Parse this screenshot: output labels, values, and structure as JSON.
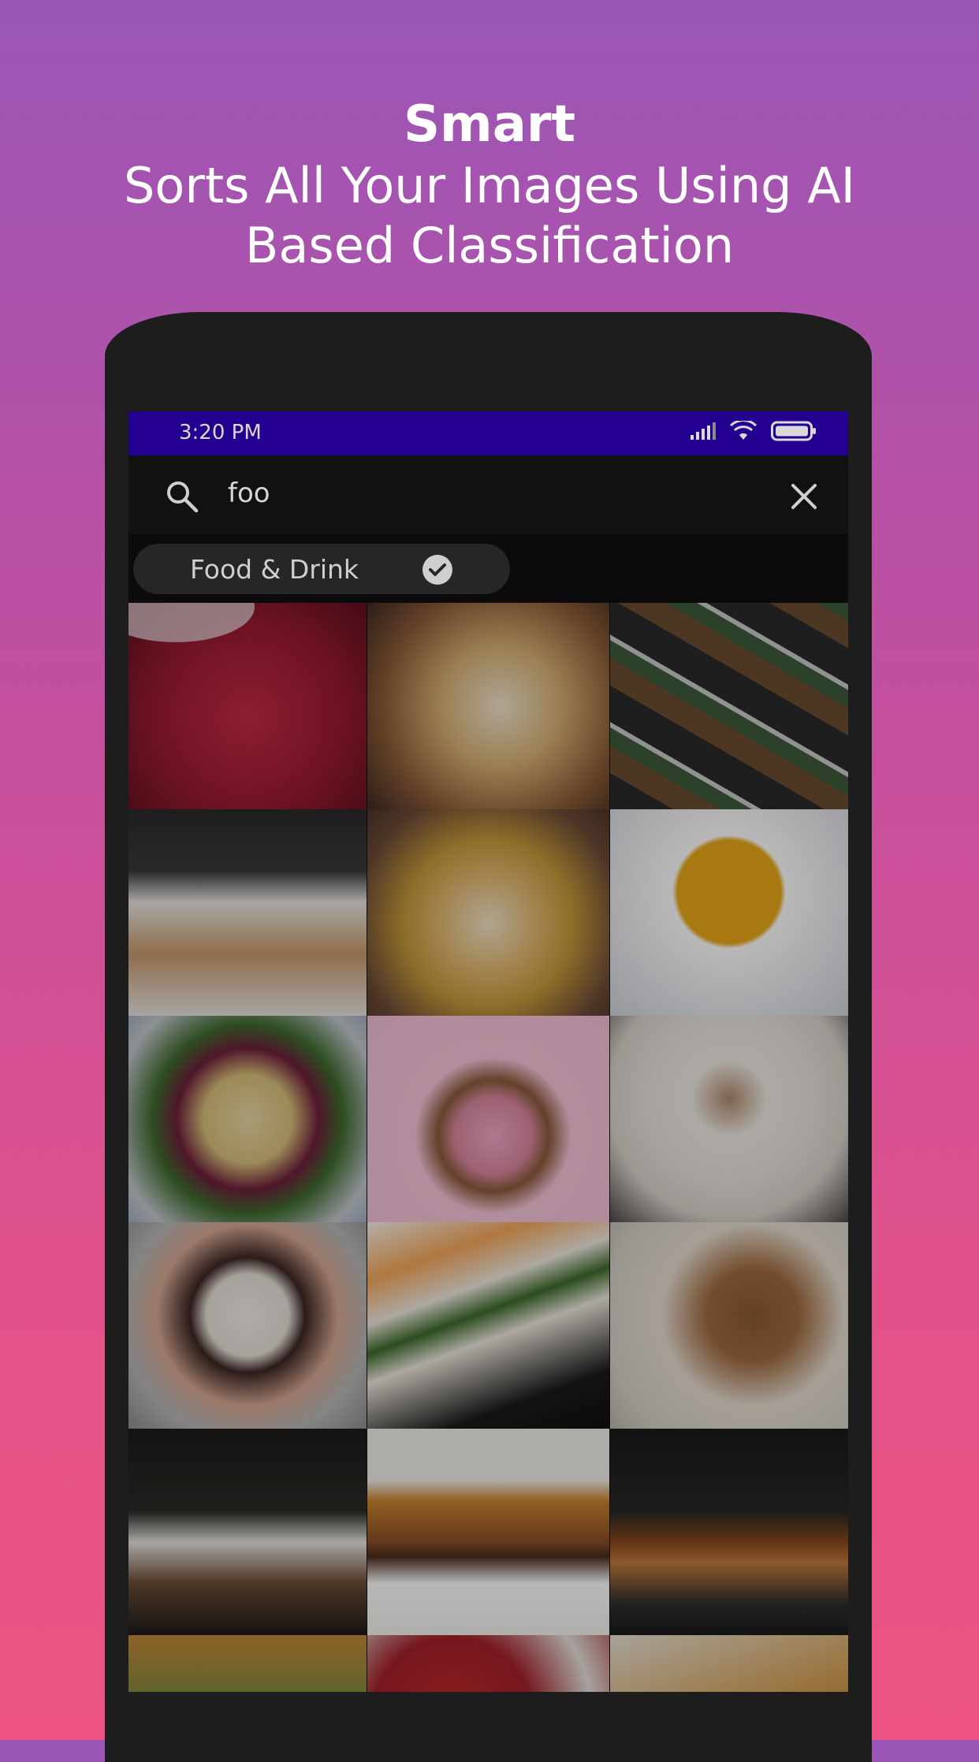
{
  "headline": {
    "title": "Smart",
    "subtitle": "Sorts All Your Images Using AI Based Classification"
  },
  "statusbar": {
    "time": "3:20 PM",
    "icons": [
      "signal-icon",
      "wifi-icon",
      "battery-icon"
    ]
  },
  "search": {
    "query": "foo",
    "icons": [
      "search-icon",
      "close-icon"
    ]
  },
  "filter_chip": {
    "label": "Food & Drink",
    "selected": true
  },
  "photos": [
    {
      "subject": "raspberries"
    },
    {
      "subject": "cheese and crackers board"
    },
    {
      "subject": "meal prep boxes"
    },
    {
      "subject": "pouring tea"
    },
    {
      "subject": "naan and dal platter"
    },
    {
      "subject": "curry soup bowl"
    },
    {
      "subject": "hummus salad platter"
    },
    {
      "subject": "pink donuts"
    },
    {
      "subject": "coffee cup"
    },
    {
      "subject": "skull cupcake"
    },
    {
      "subject": "sushi rolls"
    },
    {
      "subject": "stack of cookies"
    },
    {
      "subject": "coffee brewing"
    },
    {
      "subject": "layered cake"
    },
    {
      "subject": "iced drink pour"
    },
    {
      "subject": "partial photo"
    },
    {
      "subject": "strawberries"
    },
    {
      "subject": "partial photo"
    }
  ],
  "colors": {
    "statusbar": "#23008f",
    "gradient_top": "#9a56b6",
    "gradient_bottom": "#ec5380"
  }
}
